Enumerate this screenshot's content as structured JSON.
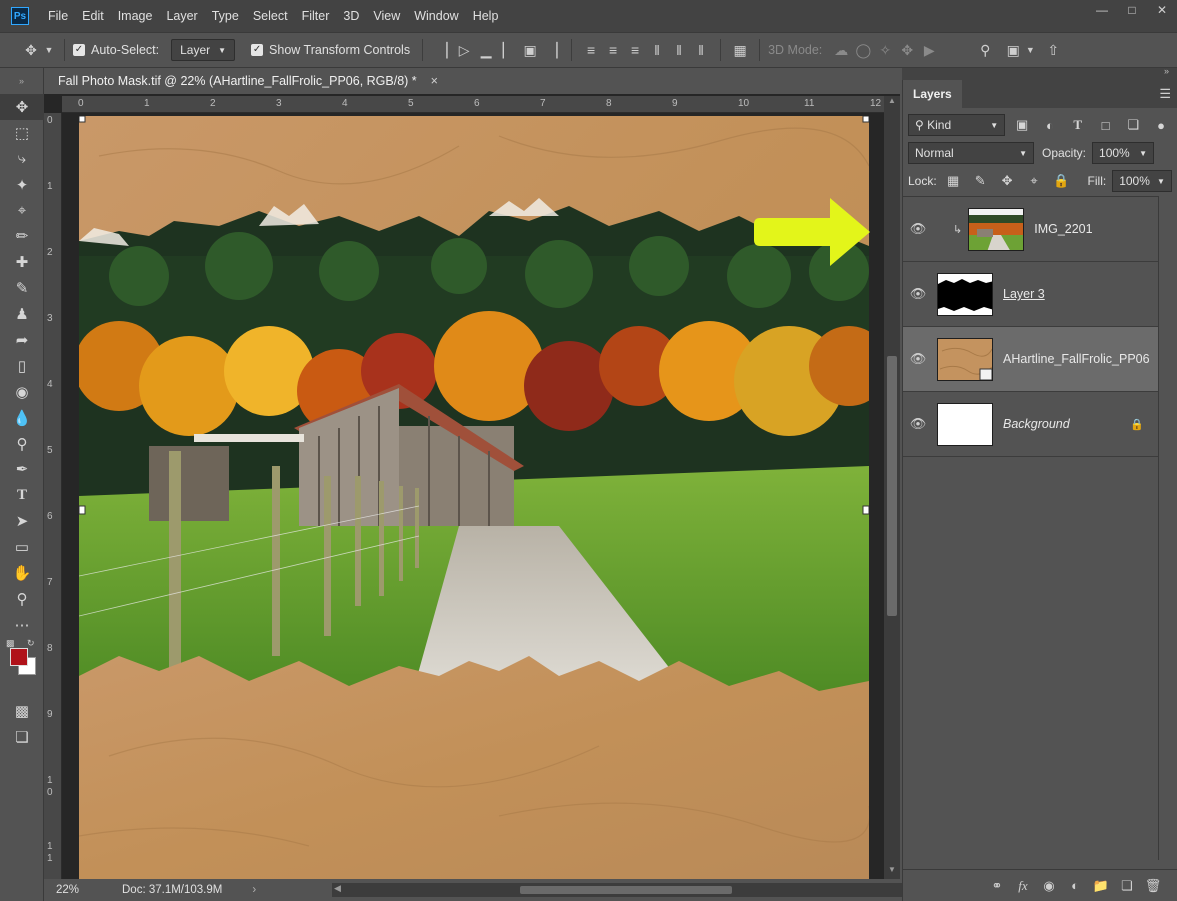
{
  "app": {
    "logo": "Ps",
    "menu": [
      "File",
      "Edit",
      "Image",
      "Layer",
      "Type",
      "Select",
      "Filter",
      "3D",
      "View",
      "Window",
      "Help"
    ]
  },
  "options": {
    "auto_select_label": "Auto-Select:",
    "auto_select_value": "Layer",
    "transform_label": "Show Transform Controls",
    "mode_3d_label": "3D Mode:"
  },
  "document": {
    "tab_title": "Fall Photo Mask.tif @ 22% (AHartline_FallFrolic_PP06, RGB/8) *",
    "close_glyph": "×",
    "ruler_top": [
      "0",
      "1",
      "2",
      "3",
      "4",
      "5",
      "6",
      "7",
      "8",
      "9",
      "10",
      "11",
      "12"
    ],
    "ruler_left": [
      "0",
      "1",
      "2",
      "3",
      "4",
      "5",
      "6",
      "7",
      "8",
      "9",
      "1 0",
      "1 1"
    ],
    "zoom": "22%",
    "doc_info": "Doc: 37.1M/103.9M"
  },
  "panel": {
    "tab": "Layers",
    "filter_value": "Kind",
    "blend_mode": "Normal",
    "opacity_label": "Opacity:",
    "opacity_value": "100%",
    "lock_label": "Lock:",
    "fill_label": "Fill:",
    "fill_value": "100%",
    "layers": [
      {
        "name": "IMG_2201",
        "visible": true,
        "clipped": true
      },
      {
        "name": "Layer 3",
        "visible": true
      },
      {
        "name": "AHartline_FallFrolic_PP06",
        "visible": true,
        "selected": true
      },
      {
        "name": "Background",
        "visible": true,
        "locked": true
      }
    ]
  },
  "colors": {
    "foreground": "#b0121a",
    "background": "#ffffff",
    "arrow": "#e3f51a",
    "paper": "#c4935f"
  }
}
